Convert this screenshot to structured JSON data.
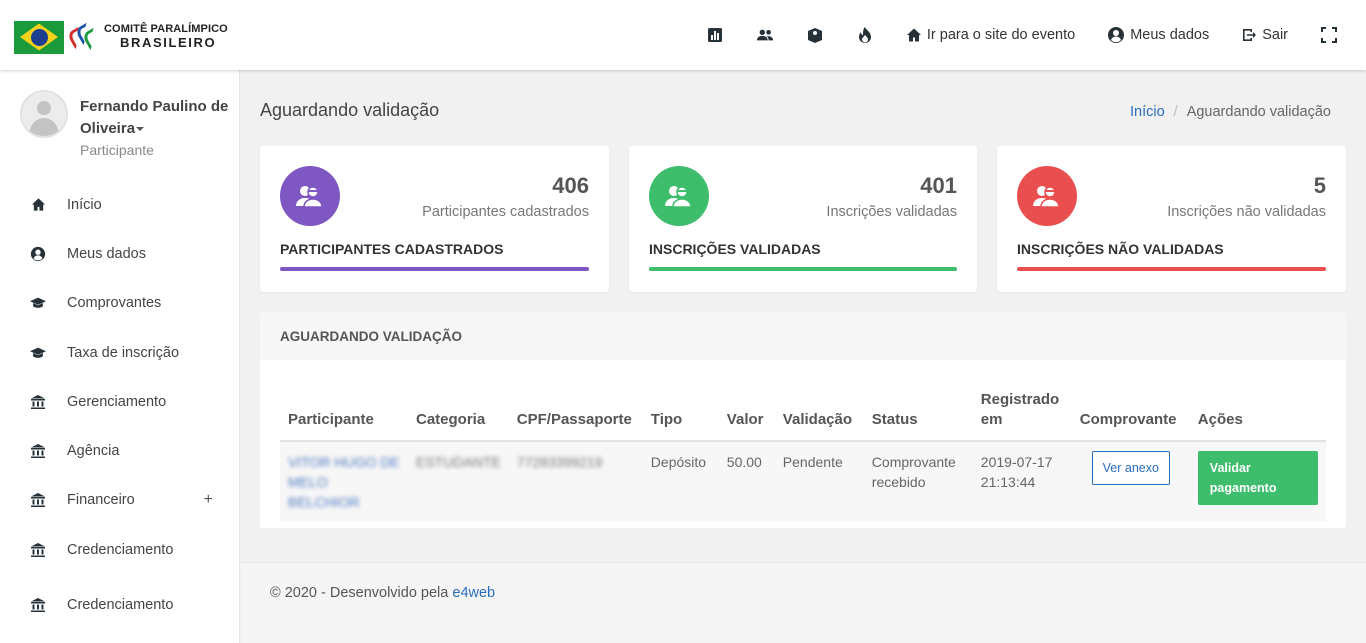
{
  "header": {
    "logo_line1": "COMITÊ PARALÍMPICO",
    "logo_line2": "BRASILEIRO",
    "nav": {
      "icons": [
        "chart-icon",
        "users-icon",
        "book-icon",
        "fire-icon"
      ],
      "site_link": "Ir para o site do evento",
      "my_data": "Meus dados",
      "logout": "Sair"
    }
  },
  "profile": {
    "name": "Fernando Paulino de Oliveira",
    "role": "Participante"
  },
  "sidebar": {
    "items": [
      {
        "label": "Início",
        "icon": "home-icon"
      },
      {
        "label": "Meus dados",
        "icon": "user-circle-icon"
      },
      {
        "label": "Comprovantes",
        "icon": "graduation-cap-icon"
      },
      {
        "label": "Taxa de inscrição",
        "icon": "graduation-cap-icon"
      },
      {
        "label": "Gerenciamento",
        "icon": "bank-icon"
      },
      {
        "label": "Agência",
        "icon": "bank-icon"
      },
      {
        "label": "Financeiro",
        "icon": "bank-icon",
        "expand": "+"
      },
      {
        "label": "Credenciamento",
        "icon": "bank-icon"
      },
      {
        "label": "Credenciamento",
        "icon": "bank-icon"
      }
    ]
  },
  "page": {
    "title": "Aguardando validação",
    "breadcrumb": {
      "home": "Início",
      "separator": "/",
      "current": "Aguardando validação"
    }
  },
  "cards": [
    {
      "number": "406",
      "subtitle": "Participantes cadastrados",
      "title": "PARTICIPANTES CADASTRADOS",
      "color": "#7e57c2"
    },
    {
      "number": "401",
      "subtitle": "Inscrições validadas",
      "title": "INSCRIÇÕES VALIDADAS",
      "color": "#3ebd6c"
    },
    {
      "number": "5",
      "subtitle": "Inscrições não validadas",
      "title": "INSCRIÇÕES NÃO VALIDADAS",
      "color": "#ea4f4f"
    }
  ],
  "panel": {
    "title": "AGUARDANDO VALIDAÇÃO",
    "columns": [
      "Participante",
      "Categoria",
      "CPF/Passaporte",
      "Tipo",
      "Valor",
      "Validação",
      "Status",
      "Registrado em",
      "Comprovante",
      "Ações"
    ],
    "rows": [
      {
        "participant": "VITOR HUGO DE MELO BELCHIOR",
        "category": "ESTUDANTE",
        "document": "77283399219",
        "type": "Depósito",
        "value": "50.00",
        "validation": "Pendente",
        "status": "Comprovante recebido",
        "registered": "2019-07-17 21:13:44",
        "receipt_button": "Ver anexo",
        "action_button": "Validar pagamento"
      }
    ]
  },
  "footer": {
    "text": "© 2020 - Desenvolvido pela ",
    "link": "e4web"
  },
  "colors": {
    "accent_link": "#2a6ebb",
    "purple": "#7e57c2",
    "green": "#3ebd6c",
    "red": "#ea4f4f"
  }
}
